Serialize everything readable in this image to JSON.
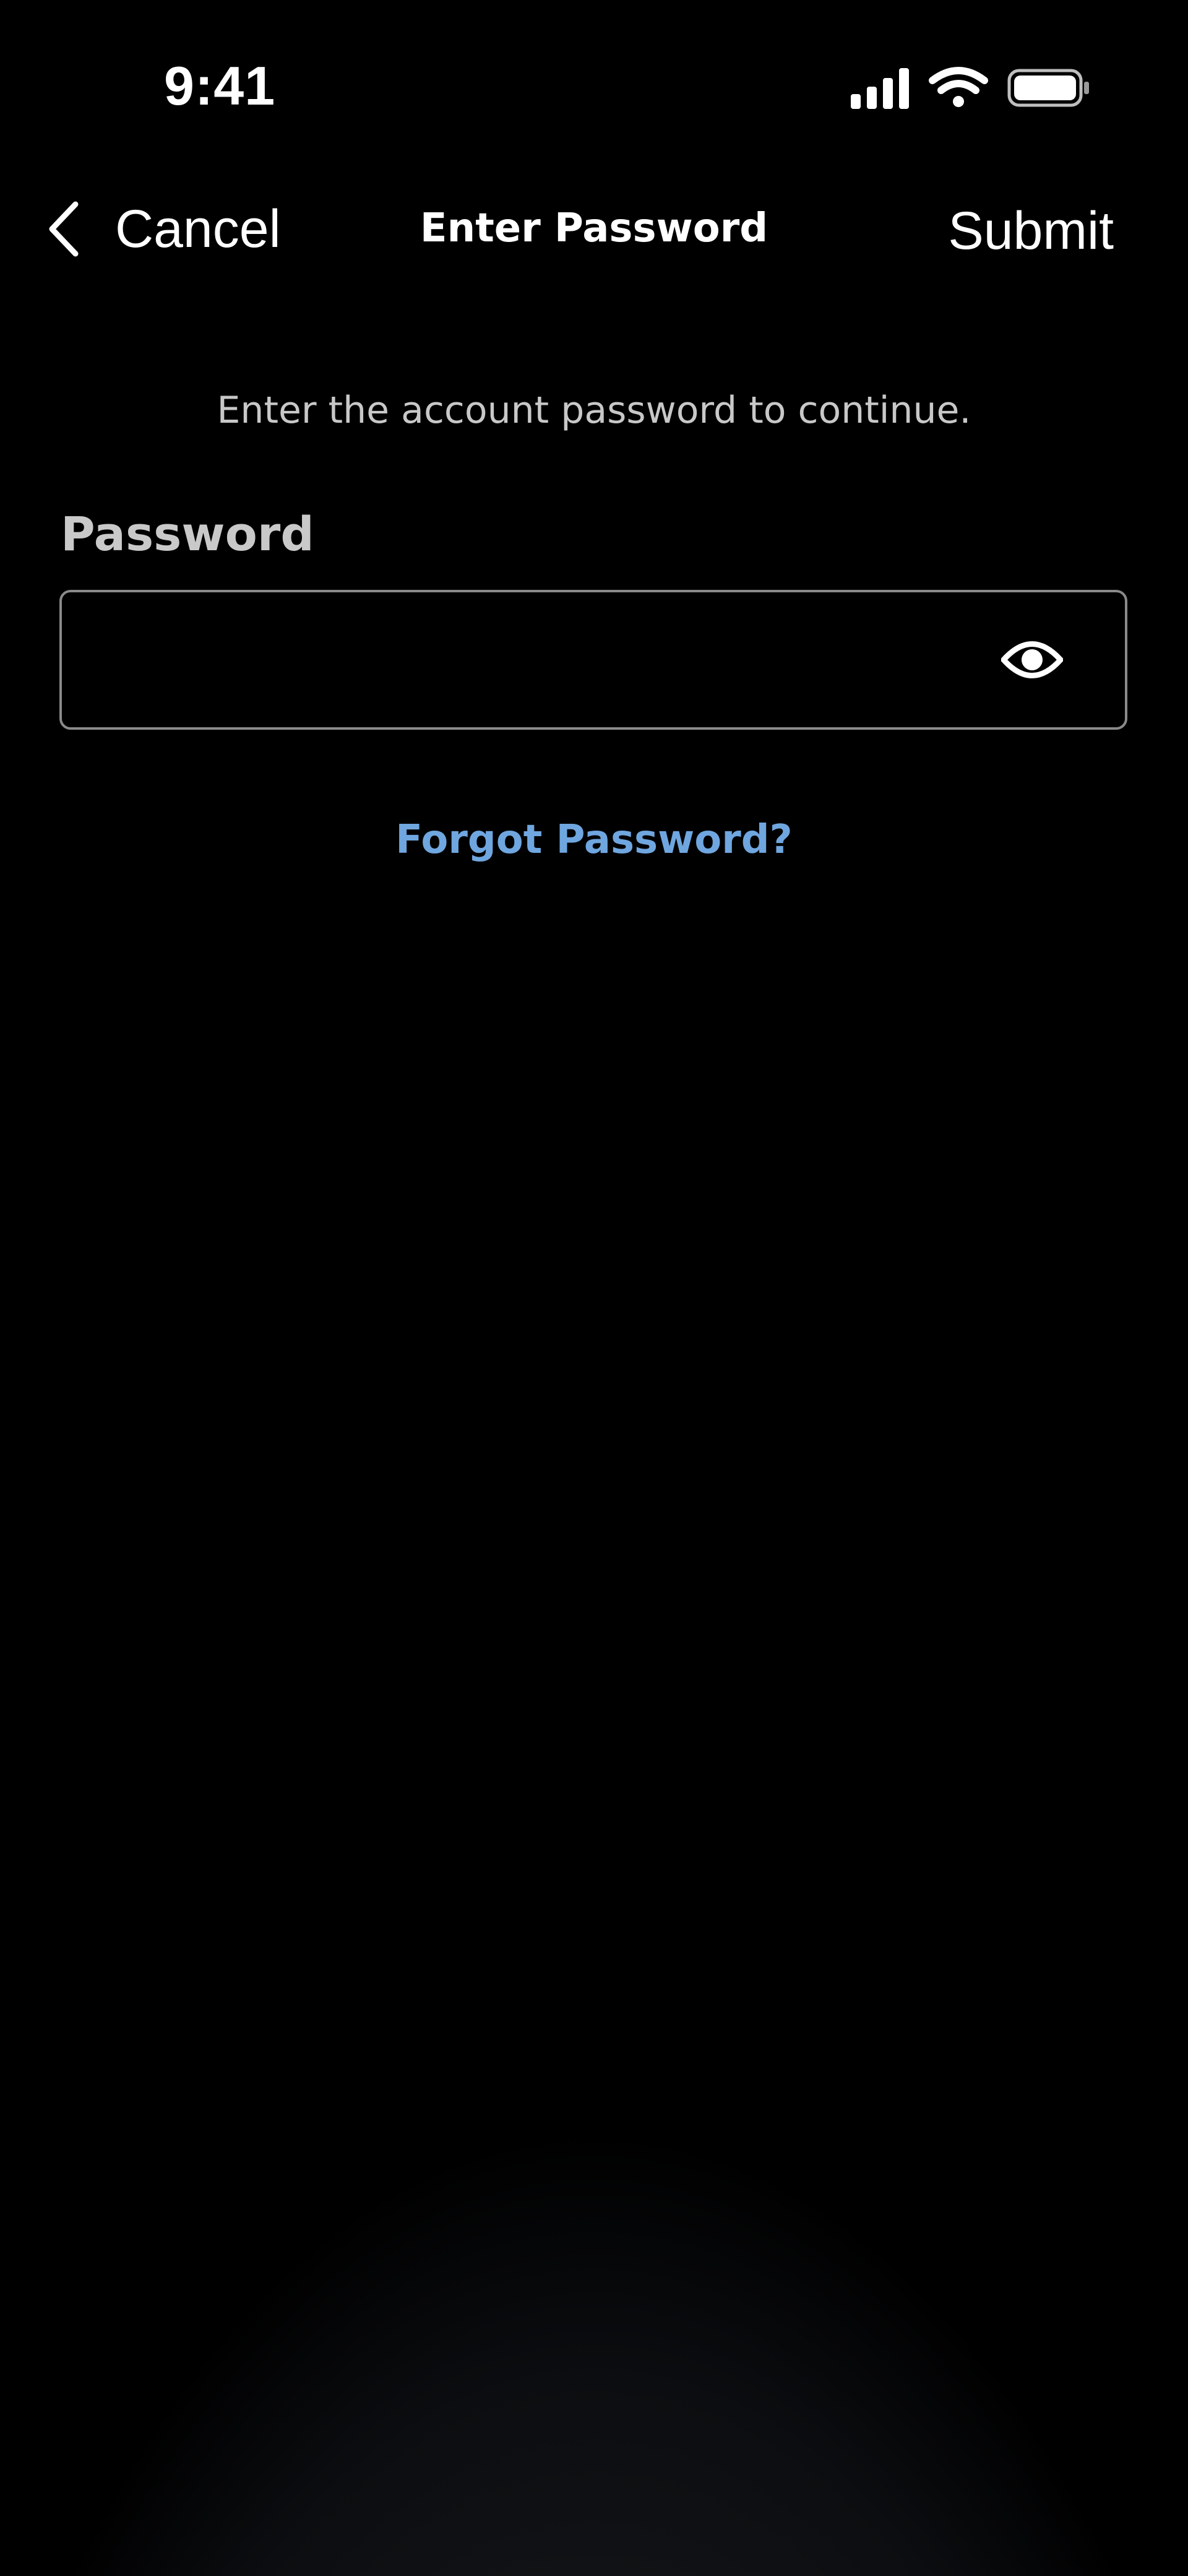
{
  "status_bar": {
    "time": "9:41",
    "icons": [
      "signal-icon",
      "wifi-icon",
      "battery-icon"
    ]
  },
  "nav": {
    "back_icon": "chevron-left-icon",
    "cancel_label": "Cancel",
    "title": "Enter Password",
    "submit_label": "Submit"
  },
  "form": {
    "instruction": "Enter the account password to continue.",
    "password_label": "Password",
    "password_value": "",
    "password_placeholder": "",
    "visibility_icon": "eye-icon",
    "forgot_password_label": "Forgot Password?"
  },
  "colors": {
    "background": "#000000",
    "text": "#ffffff",
    "secondary_text": "#c8c8c8",
    "link": "#6fa6df",
    "field_border": "#8a8a8a"
  }
}
